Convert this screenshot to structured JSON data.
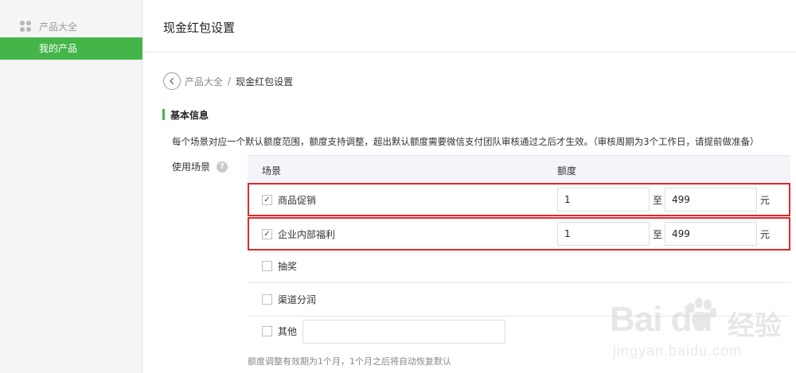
{
  "sidebar": {
    "category_icon": "grid-dots-icon",
    "category_label": "产品大全",
    "active_item": "我的产品"
  },
  "header": {
    "title": "现金红包设置"
  },
  "breadcrumb": {
    "back_icon": "chevron-left-icon",
    "parent": "产品大全",
    "separator": "/",
    "current": "现金红包设置"
  },
  "section": {
    "title": "基本信息",
    "description": "每个场景对应一个默认额度范围，额度支持调整，超出默认额度需要微信支付团队审核通过之后才生效。（审核周期为3个工作日，请提前做准备）",
    "field_label": "使用场景",
    "help_icon": "question-mark-icon",
    "help_glyph": "?"
  },
  "table": {
    "headers": [
      "场景",
      "额度"
    ],
    "rows": [
      {
        "scene": "商品促销",
        "checked": true,
        "min": "1",
        "max": "499",
        "to": "至",
        "unit": "元"
      },
      {
        "scene": "企业内部福利",
        "checked": true,
        "min": "1",
        "max": "499",
        "to": "至",
        "unit": "元"
      },
      {
        "scene": "抽奖",
        "checked": false
      },
      {
        "scene": "渠道分润",
        "checked": false
      },
      {
        "scene": "其他",
        "checked": false,
        "other_value": ""
      }
    ],
    "check_mark": "✓"
  },
  "note": "额度调整有效期为1个月，1个月之后将自动恢复默认",
  "watermark": {
    "brand": "Bai du",
    "cn": "经验",
    "url": "jingyan.baidu.com"
  },
  "colors": {
    "accent_green": "#44b549",
    "highlight_red": "#e0292c"
  }
}
